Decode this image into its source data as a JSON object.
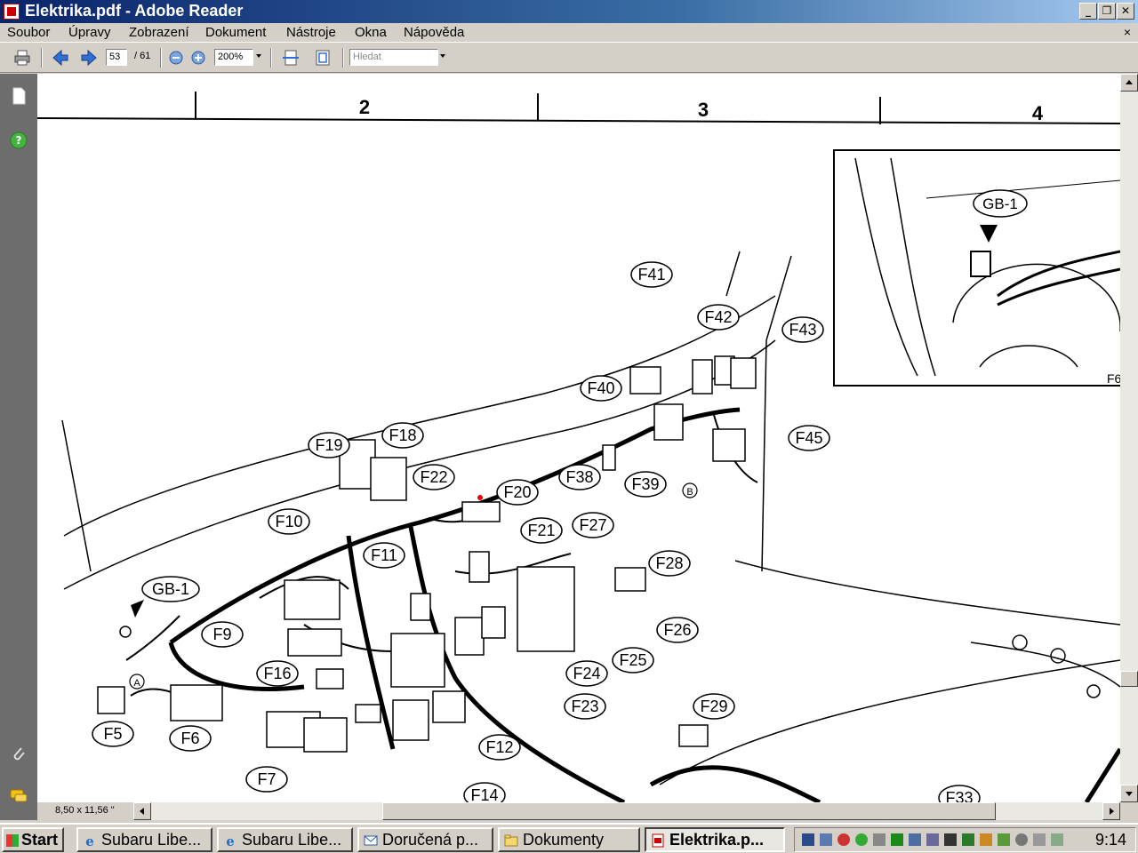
{
  "window": {
    "title": "Elektrika.pdf - Adobe Reader"
  },
  "menu": {
    "items": [
      "Soubor",
      "Úpravy",
      "Zobrazení",
      "Dokument",
      "Nástroje",
      "Okna",
      "Nápověda"
    ],
    "close_doc": "×"
  },
  "toolbar": {
    "page_current": "53",
    "page_total": "/ 61",
    "zoom": "200%",
    "search_placeholder": "Hledat"
  },
  "document": {
    "column_numbers": [
      "2",
      "3",
      "4"
    ],
    "connector_labels": [
      "F41",
      "F42",
      "F43",
      "F40",
      "F45",
      "F39",
      "F38",
      "F19",
      "F18",
      "F22",
      "F20",
      "F21",
      "F27",
      "F28",
      "F10",
      "F11",
      "F26",
      "F25",
      "F24",
      "F23",
      "F9",
      "F16",
      "F12",
      "F29",
      "F5",
      "F6",
      "F7",
      "F14",
      "F33",
      "GB-1"
    ],
    "inset_label": "GB-1",
    "inset_code": "F6",
    "ground_labels": [
      "A",
      "B"
    ]
  },
  "status": {
    "page_size": "8,50 x 11,56 \""
  },
  "taskbar": {
    "start": "Start",
    "tasks": [
      "Subaru Libe...",
      "Subaru Libe...",
      "Doručená p...",
      "Dokumenty",
      "Elektrika.p..."
    ],
    "clock": "9:14"
  },
  "colors": {
    "title_start": "#0a246a",
    "title_end": "#a6caf0",
    "sidebar": "#6d6d6d",
    "chrome": "#d4d0c8"
  }
}
